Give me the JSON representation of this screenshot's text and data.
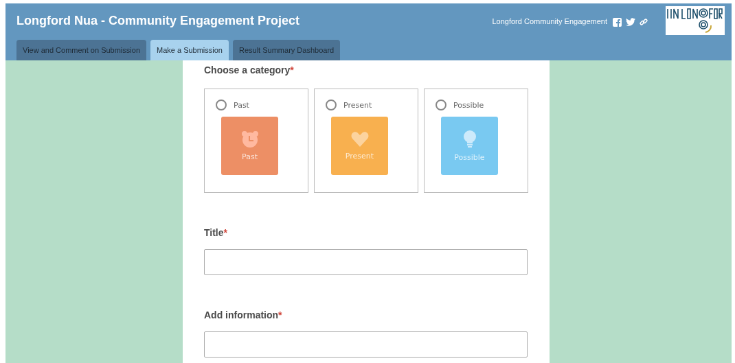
{
  "header": {
    "title": "Longford Nua - Community Engagement Project",
    "site_link": "Longford Community Engagement"
  },
  "tabs": [
    {
      "label": "View and Comment on Submission",
      "selected": false
    },
    {
      "label": "Make a Submission",
      "selected": true
    },
    {
      "label": "Result Summary Dashboard",
      "selected": false
    }
  ],
  "category": {
    "label": "Choose a category",
    "required_mark": "*",
    "options": [
      {
        "label": "Past",
        "tile_label": "Past",
        "kind": "past",
        "color": "#ed8f65",
        "selected": false
      },
      {
        "label": "Present",
        "tile_label": "Present",
        "kind": "present",
        "color": "#f8b04f",
        "selected": false
      },
      {
        "label": "Possible",
        "tile_label": "Possible",
        "kind": "possible",
        "color": "#79c9f1",
        "selected": false
      }
    ]
  },
  "fields": [
    {
      "label": "Title",
      "required_mark": "*"
    },
    {
      "label": "Add information",
      "required_mark": "*"
    }
  ]
}
